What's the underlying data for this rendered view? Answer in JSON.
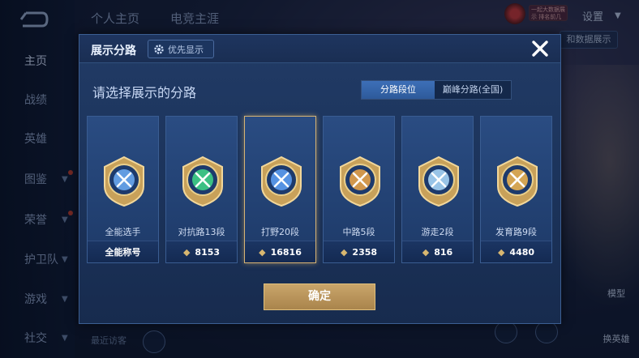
{
  "sidebar": {
    "items": [
      {
        "label": "主页",
        "chevron": false,
        "dot": false,
        "active": true
      },
      {
        "label": "战绩",
        "chevron": false,
        "dot": false
      },
      {
        "label": "英雄",
        "chevron": false,
        "dot": false
      },
      {
        "label": "图鉴",
        "chevron": true,
        "dot": true
      },
      {
        "label": "荣誉",
        "chevron": true,
        "dot": true
      },
      {
        "label": "护卫队",
        "chevron": true,
        "dot": false
      },
      {
        "label": "游戏",
        "chevron": true,
        "dot": false
      },
      {
        "label": "社交",
        "chevron": true,
        "dot": false
      }
    ]
  },
  "top": {
    "tabs": [
      "个人主页",
      "电竞主涯"
    ],
    "settings_label": "设置",
    "bg_button_label": "和数据展示",
    "badge_text": "一起大数据展示 排名前几位"
  },
  "footer": {
    "recent_visitors": "最近访客"
  },
  "right_panel": {
    "model_label": "模型",
    "swap_label": "换英雄"
  },
  "modal": {
    "title": "展示分路",
    "priority_button": "优先显示",
    "subtitle": "请选择展示的分路",
    "segments": [
      "分路段位",
      "巅峰分路(全国)"
    ],
    "confirm_label": "确定",
    "cards": [
      {
        "name": "全能选手",
        "value": "全能称号",
        "icon": "all-round-emblem-icon",
        "color": "#6aa7ee",
        "show_glyph": false,
        "selected": false
      },
      {
        "name": "对抗路13段",
        "value": "8153",
        "icon": "clash-lane-emblem-icon",
        "color": "#3fcf86",
        "show_glyph": true,
        "selected": false
      },
      {
        "name": "打野20段",
        "value": "16816",
        "icon": "jungle-emblem-icon",
        "color": "#5c9cf0",
        "show_glyph": true,
        "selected": true
      },
      {
        "name": "中路5段",
        "value": "2358",
        "icon": "mid-lane-emblem-icon",
        "color": "#e6a24a",
        "show_glyph": true,
        "selected": false
      },
      {
        "name": "游走2段",
        "value": "816",
        "icon": "roam-emblem-icon",
        "color": "#a7d4f5",
        "show_glyph": true,
        "selected": false
      },
      {
        "name": "发育路9段",
        "value": "4480",
        "icon": "farm-lane-emblem-icon",
        "color": "#e9b152",
        "show_glyph": true,
        "selected": false
      }
    ]
  }
}
